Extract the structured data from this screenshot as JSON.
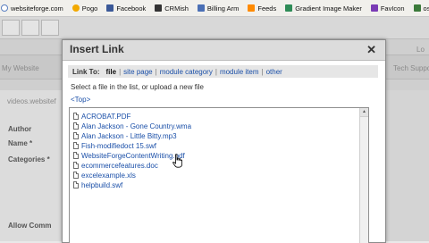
{
  "bookmarks": [
    {
      "label": "websiteforge.com",
      "icon": "globe-icon",
      "color": "#ffffff"
    },
    {
      "label": "Pogo",
      "icon": "pogo-icon",
      "color": "#f2a900"
    },
    {
      "label": "Facebook",
      "icon": "facebook-icon",
      "color": "#3b5998"
    },
    {
      "label": "CRMish",
      "icon": "crmish-icon",
      "color": "#333333"
    },
    {
      "label": "Billing Arm",
      "icon": "billing-icon",
      "color": "#4a6fb5"
    },
    {
      "label": "Feeds",
      "icon": "feed-icon",
      "color": "#ff8a00"
    },
    {
      "label": "Gradient Image Maker",
      "icon": "gradient-icon",
      "color": "#2e8b57"
    },
    {
      "label": "FavIcon",
      "icon": "favicon-icon",
      "color": "#7a3bb5"
    },
    {
      "label": "osi",
      "icon": "osi-icon",
      "color": "#3a7a3a"
    }
  ],
  "background_page": {
    "tab_left": "My Website",
    "tab_right": "Tech Suppo",
    "right_top": "Lo",
    "url_text": "videos.websitef",
    "fields": [
      "Author",
      "Name *",
      "Categories *",
      "Allow Comm"
    ]
  },
  "dialog": {
    "title": "Insert Link",
    "close": "✕",
    "link_to_label": "Link To:",
    "link_options": [
      "file",
      "site page",
      "module category",
      "module item",
      "other"
    ],
    "selected_option": "file",
    "instructions": "Select a file in the list, or upload a new file",
    "path": "<Top>",
    "files": [
      "ACROBAT.PDF",
      "Alan Jackson - Gone Country.wma",
      "Alan Jackson - Little Bitty.mp3",
      "Fish-modifiedoct 15.swf",
      "WebsiteForgeContentWriting.pdf",
      "ecommercefeatures.doc",
      "excelexample.xls",
      "helpbuild.swf"
    ],
    "scroll_up": "▲"
  }
}
